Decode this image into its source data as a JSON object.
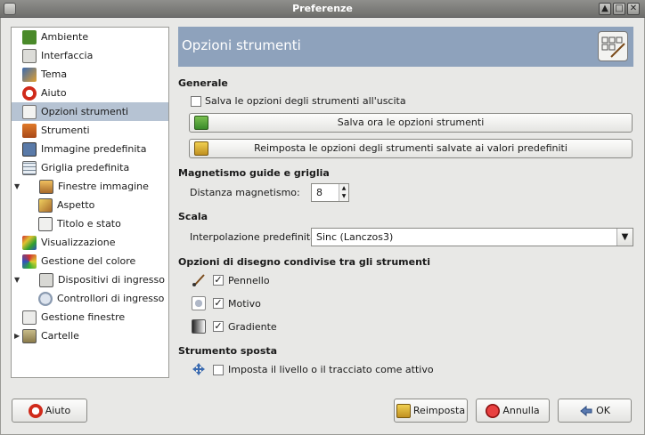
{
  "window": {
    "title": "Preferenze"
  },
  "sidebar": {
    "items": [
      {
        "label": "Ambiente",
        "icon": "ambiente-icon",
        "color": "#4a8a2a"
      },
      {
        "label": "Interfaccia",
        "icon": "interfaccia-icon",
        "color": "#6a6a66"
      },
      {
        "label": "Tema",
        "icon": "tema-icon",
        "color": "#d98a2a"
      },
      {
        "label": "Aiuto",
        "icon": "aiuto-icon",
        "color": "#d02a1a"
      },
      {
        "label": "Opzioni strumenti",
        "icon": "opzioni-strumenti-icon",
        "color": "#888884",
        "selected": true
      },
      {
        "label": "Strumenti",
        "icon": "strumenti-icon",
        "color": "#c05818"
      },
      {
        "label": "Immagine predefinita",
        "icon": "immagine-predefinita-icon",
        "color": "#5a7aa8"
      },
      {
        "label": "Griglia predefinita",
        "icon": "griglia-predefinita-icon",
        "color": "#7a8a9a"
      },
      {
        "label": "Finestre immagine",
        "icon": "finestre-immagine-icon",
        "color": "#a86a2a",
        "expanded": true
      },
      {
        "label": "Aspetto",
        "icon": "aspetto-icon",
        "color": "#d0a02a",
        "child": true
      },
      {
        "label": "Titolo e stato",
        "icon": "titolo-stato-icon",
        "color": "#c04040",
        "child": true
      },
      {
        "label": "Visualizzazione",
        "icon": "visualizzazione-icon",
        "color": "#c83030"
      },
      {
        "label": "Gestione del colore",
        "icon": "gestione-colore-icon",
        "color": "#3a9a3a"
      },
      {
        "label": "Dispositivi di ingresso",
        "icon": "dispositivi-ingresso-icon",
        "color": "#6a6a66",
        "expanded": true
      },
      {
        "label": "Controllori di ingresso",
        "icon": "controllori-ingresso-icon",
        "color": "#8a9ab0",
        "child": true
      },
      {
        "label": "Gestione finestre",
        "icon": "gestione-finestre-icon",
        "color": "#8a8a86"
      },
      {
        "label": "Cartelle",
        "icon": "cartelle-icon",
        "color": "#a89a6a",
        "collapsed": true
      }
    ]
  },
  "banner": {
    "title": "Opzioni strumenti"
  },
  "generale": {
    "heading": "Generale",
    "save_on_exit_label": "Salva le opzioni degli strumenti all'uscita",
    "save_on_exit_checked": false,
    "save_now_label": "Salva ora le opzioni strumenti",
    "reset_label": "Reimposta le opzioni degli strumenti salvate ai valori predefiniti"
  },
  "magnetismo": {
    "heading": "Magnetismo guide e griglia",
    "distance_label": "Distanza magnetismo:",
    "distance_value": "8"
  },
  "scala": {
    "heading": "Scala",
    "interp_label": "Interpolazione predefinita:",
    "interp_value": "Sinc (Lanczos3)"
  },
  "disegno": {
    "heading": "Opzioni di disegno condivise tra gli strumenti",
    "items": [
      {
        "label": "Pennello",
        "checked": true,
        "icon": "paintbrush-icon"
      },
      {
        "label": "Motivo",
        "checked": true,
        "icon": "pattern-icon"
      },
      {
        "label": "Gradiente",
        "checked": true,
        "icon": "gradient-icon"
      }
    ]
  },
  "sposta": {
    "heading": "Strumento sposta",
    "active_label": "Imposta il livello o il tracciato come attivo",
    "active_checked": false
  },
  "buttons": {
    "help": "Aiuto",
    "reset": "Reimposta",
    "cancel": "Annulla",
    "ok": "OK"
  },
  "colors": {
    "banner": "#8ea2bc",
    "selection": "#b6c3d3"
  }
}
